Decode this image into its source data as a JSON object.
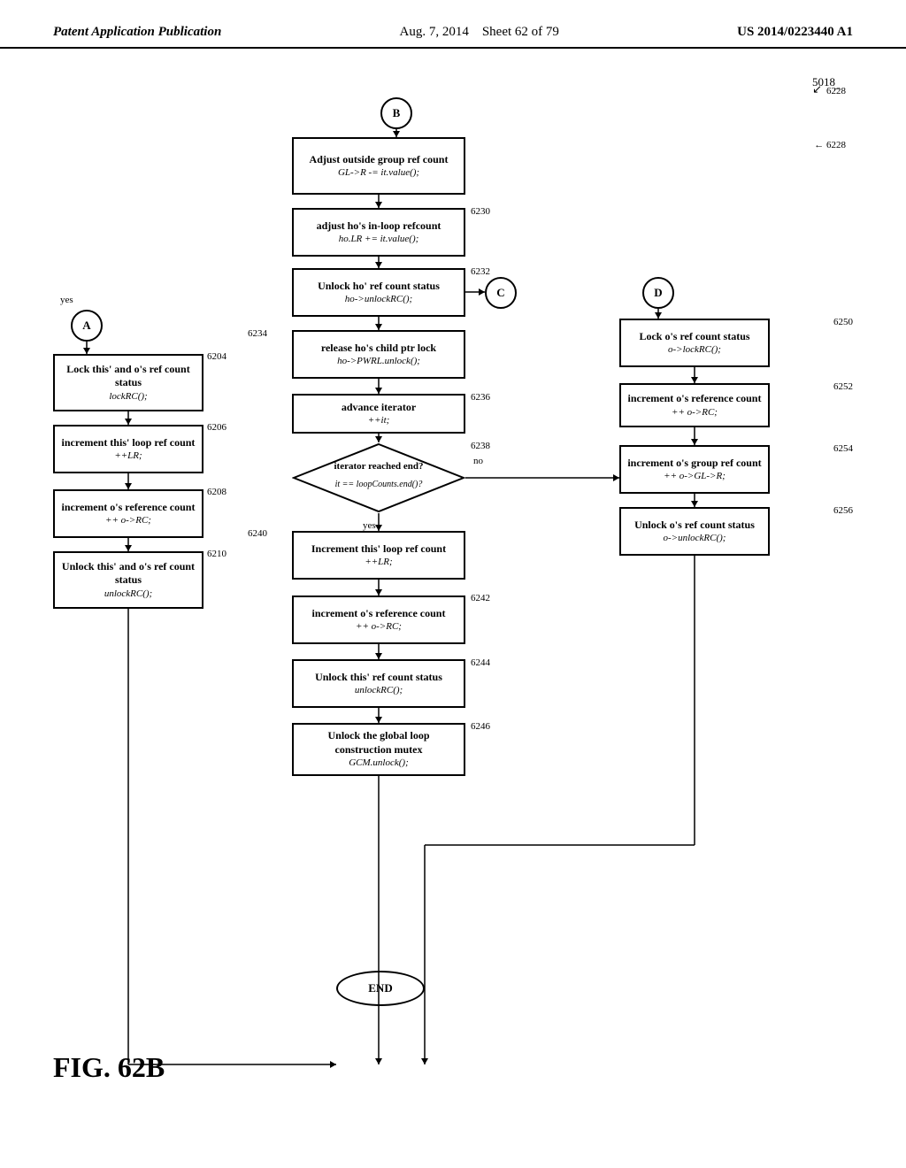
{
  "header": {
    "left": "Patent Application Publication",
    "center_date": "Aug. 7, 2014",
    "center_sheet": "Sheet 62 of 79",
    "right": "US 2014/0223440 A1"
  },
  "fig_label": "FIG. 62B",
  "diagram_ref": "5018",
  "nodes": {
    "B_circle": {
      "label": "B"
    },
    "C_circle": {
      "label": "C"
    },
    "D_circle": {
      "label": "D"
    },
    "A_circle": {
      "label": "A"
    },
    "END_oval": {
      "label": "END"
    },
    "box6228": {
      "id": "6228",
      "title": "Adjust outside group ref count",
      "code": "GL->R -= it.value();"
    },
    "box6230": {
      "id": "6230",
      "title": "adjust ho's in-loop refcount",
      "code": "ho.LR += it.value();"
    },
    "box6232": {
      "id": "6232",
      "title": "Unlock ho' ref count status",
      "code": "ho->unlockRC();"
    },
    "box6234": {
      "id": "6234",
      "title": "release ho's child ptr lock",
      "code": "ho->PWRL.unlock();"
    },
    "box6236": {
      "id": "6236",
      "title": "advance iterator",
      "code": "++it;"
    },
    "diamond6238": {
      "id": "6238",
      "question": "iterator reached end?",
      "code": "it == loopCounts.end()?"
    },
    "box6240": {
      "id": "6240",
      "title": "Increment this' loop ref count",
      "code": "++LR;"
    },
    "box6242": {
      "id": "6242",
      "title": "increment o's reference count",
      "code": "++ o->RC;"
    },
    "box6244": {
      "id": "6244",
      "title": "Unlock this' ref count status",
      "code": "unlockRC();"
    },
    "box6246": {
      "id": "6246",
      "title": "Unlock the global loop construction mutex",
      "code": "GCM.unlock();"
    },
    "box6204": {
      "id": "6204",
      "title": "Lock this' and o's ref count status",
      "code": "lockRC();"
    },
    "box6206": {
      "id": "6206",
      "title": "increment this' loop ref count",
      "code": "++LR;"
    },
    "box6208": {
      "id": "6208",
      "title": "increment o's reference count",
      "code": "++ o->RC;"
    },
    "box6210": {
      "id": "6210",
      "title": "Unlock this' and o's ref count status",
      "code": "unlockRC();"
    },
    "box6250": {
      "id": "6250",
      "title": "Lock o's ref count status",
      "code": "o->lockRC();"
    },
    "box6252": {
      "id": "6252",
      "title": "increment o's reference count",
      "code": "++ o->RC;"
    },
    "box6254": {
      "id": "6254",
      "title": "increment o's group ref count",
      "code": "++ o->GL->R;"
    },
    "box6256": {
      "id": "6256",
      "title": "Unlock o's ref count status",
      "code": "o->unlockRC();"
    }
  }
}
